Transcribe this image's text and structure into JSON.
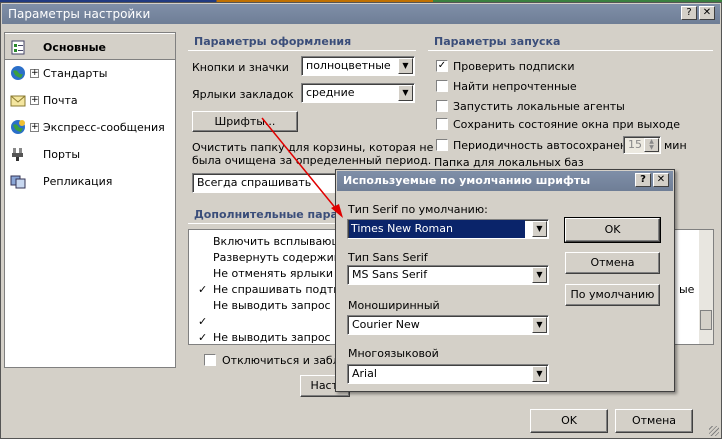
{
  "window": {
    "title": "Параметры настройки",
    "help_glyph": "?",
    "close_glyph": "✕"
  },
  "sidebar": {
    "items": [
      {
        "label": "Основные",
        "selected": true,
        "expandable": false,
        "icon": "checklist-icon"
      },
      {
        "label": "Стандарты",
        "selected": false,
        "expandable": true,
        "icon": "globe-icon"
      },
      {
        "label": "Почта",
        "selected": false,
        "expandable": true,
        "icon": "envelope-icon"
      },
      {
        "label": "Экспресс-сообщения",
        "selected": false,
        "expandable": true,
        "icon": "globe-chat-icon"
      },
      {
        "label": "Порты",
        "selected": false,
        "expandable": false,
        "icon": "plug-icon"
      },
      {
        "label": "Репликация",
        "selected": false,
        "expandable": false,
        "icon": "replication-icon"
      }
    ],
    "plus_glyph": "+"
  },
  "appearance": {
    "title": "Параметры оформления",
    "buttons_icons_label": "Кнопки и значки",
    "buttons_icons_value": "полноцветные",
    "tab_labels_label": "Ярлыки закладок",
    "tab_labels_value": "средние",
    "fonts_button": "Шрифты...",
    "trash_text_line1": "Очистить папку для корзины, которая не",
    "trash_text_line2": "была очищена за определенный период.",
    "trash_value": "Всегда спрашивать"
  },
  "startup": {
    "title": "Параметры запуска",
    "options": [
      {
        "label": "Проверить подписки",
        "checked": true
      },
      {
        "label": "Найти непрочтенные",
        "checked": false
      },
      {
        "label": "Запустить локальные агенты",
        "checked": false
      },
      {
        "label": "Сохранить состояние окна при выходе",
        "checked": false
      },
      {
        "label": "Периодичность автосохранения",
        "checked": false
      }
    ],
    "autosave_value": "15",
    "autosave_unit": "мин",
    "local_db_label": "Папка для локальных баз"
  },
  "additional": {
    "title": "Дополнительные парам",
    "items": [
      {
        "label": "Включить всплывающи",
        "checked": false
      },
      {
        "label": "Развернуть содержимо",
        "checked": false
      },
      {
        "label": "Не отменять ярлыки в д",
        "checked": false
      },
      {
        "label": "Не спрашивать подтвер",
        "checked": true
      },
      {
        "label": "Не выводить запрос пр",
        "checked": false
      },
      {
        "label": "",
        "checked": true
      },
      {
        "label": "Не выводить запрос пр",
        "checked": true
      }
    ],
    "right_fragment": "ые",
    "check_glyph": "✓",
    "disconnect_label": "Отключиться и заблок",
    "configure_button": "Настр"
  },
  "footer": {
    "ok": "OK",
    "cancel": "Отмена"
  },
  "font_dialog": {
    "title": "Используемые по умолчанию шрифты",
    "help_glyph": "?",
    "close_glyph": "✕",
    "serif_label": "Тип Serif по умолчанию:",
    "serif_value": "Times New Roman",
    "sans_label": "Тип Sans Serif",
    "sans_value": "MS Sans Serif",
    "mono_label": "Моноширинный",
    "mono_value": "Courier New",
    "multi_label": "Многоязыковой",
    "multi_value": "Arial",
    "ok_button": "OK",
    "cancel_button": "Отмена",
    "default_button": "По умолчанию"
  },
  "colors": {
    "arrow": "#e00000",
    "title_bar": "#7384a0",
    "group_title": "#3b4e7a",
    "selected_combo": "#0a246a"
  }
}
